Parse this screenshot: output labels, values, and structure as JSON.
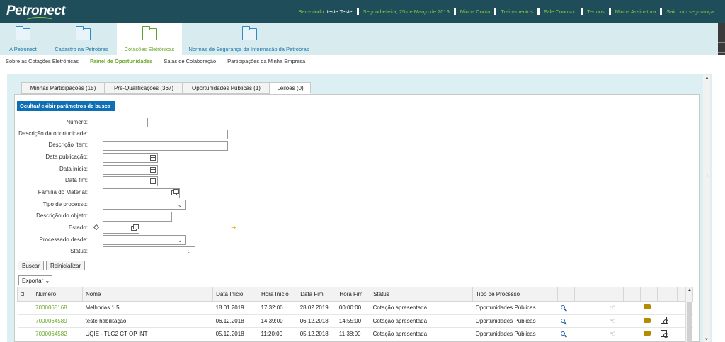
{
  "header": {
    "logo": "Petronect",
    "welcome_prefix": "Bem-vindo:",
    "user": "teste Teste",
    "date": "Segunda-feira, 25 de Março de 2019",
    "links": [
      "Minha Conta",
      "Treinamentos",
      "Fale Conosco",
      "Termos",
      "Minha Assinatura",
      "Sair com segurança"
    ]
  },
  "main_tabs": [
    "A Petronect",
    "Cadastro na Petrobras",
    "Cotações Eletrônicas",
    "Normas de Segurança da Informação da Petrobras"
  ],
  "subnav": [
    "Sobre as Cotações Eletrônicas",
    "Painel de Oportunidades",
    "Salas de Colaboração",
    "Participações da Minha Empresa"
  ],
  "subtabs": [
    "Minhas Participações (15)",
    "Pré-Qualificações (367)",
    "Oportunidades Públicas (1)",
    "Leilões (0)"
  ],
  "toggle_button": "Ocultar/ exibir parâmetros de busca",
  "form_labels": [
    "Número:",
    "Descrição da oportunidade:",
    "Descrição ítem:",
    "Data publicação:",
    "Data início:",
    "Data fim:",
    "Família do Material:",
    "Tipo de processo:",
    "Descrição do objeto:",
    "Estado:",
    "Processado desde:",
    "Status:"
  ],
  "buttons": {
    "search": "Buscar",
    "reset": "Reinicializar",
    "export": "Exportar"
  },
  "table": {
    "headers": [
      "Número",
      "Nome",
      "Data Início",
      "Hora Início",
      "Data Fim",
      "Hora Fim",
      "Status",
      "Tipo de Processo"
    ],
    "rows": [
      [
        "7000065168",
        "Melhorias 1.5",
        "18.01.2019",
        "17:32:00",
        "28.02.2019",
        "00:00:00",
        "Cotação apresentada",
        "Oportunidades Públicas"
      ],
      [
        "7000064589",
        "teste habilitação",
        "06.12.2018",
        "14:39:00",
        "06.12.2018",
        "14:55:00",
        "Cotação apresentada",
        "Oportunidades Públicas"
      ],
      [
        "7000064582",
        "UQIE - TLG2 CT OP INT",
        "05.12.2018",
        "11:20:00",
        "05.12.2018",
        "11:38:00",
        "Cotação apresentada",
        "Oportunidades Públicas"
      ]
    ]
  },
  "colors": {
    "header_bg": "#1f4e5a",
    "accent_green": "#6aa62a",
    "primary_blue": "#0f6fb5"
  }
}
